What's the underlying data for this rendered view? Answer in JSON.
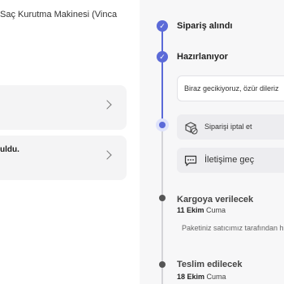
{
  "left": {
    "product_name": "Saç Kurutma Makinesi (Vinca",
    "cards": [
      {
        "text": ""
      },
      {
        "text": "uldu."
      }
    ]
  },
  "timeline": {
    "steps": [
      {
        "title": "Sipariş alındı",
        "status": "completed"
      },
      {
        "title": "Hazırlanıyor",
        "status": "completed",
        "message": "Biraz gecikiyoruz, özür dileriz"
      },
      {
        "title": "Kargoya verilecek",
        "status": "pending",
        "date_bold": "11 Ekim",
        "date_day": "Cuma",
        "note": "Paketiniz satıcımız tarafından h"
      },
      {
        "title": "Teslim edilecek",
        "status": "pending",
        "date_bold": "18 Ekim",
        "date_day": "Cuma"
      }
    ],
    "actions": {
      "cancel_label": "Siparişi iptal et",
      "contact_label": "İletişime geç"
    }
  },
  "colors": {
    "accent": "#5b6ad8",
    "panel_bg": "#f7f7f8",
    "card_bg": "#f4f4f5"
  }
}
